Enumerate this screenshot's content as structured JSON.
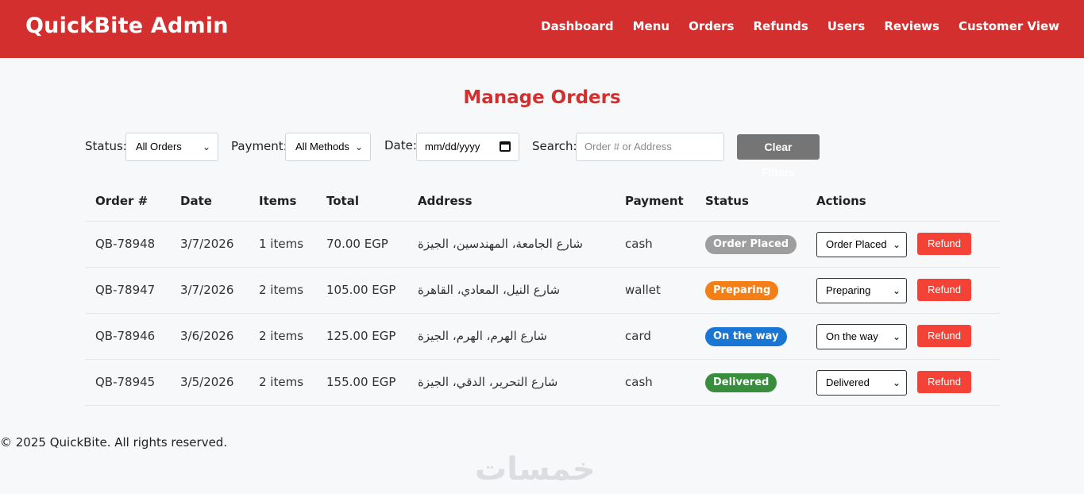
{
  "app": {
    "brand": "QuickBite Admin",
    "nav": [
      "Dashboard",
      "Menu",
      "Orders",
      "Refunds",
      "Users",
      "Reviews",
      "Customer View"
    ]
  },
  "page": {
    "title": "Manage Orders"
  },
  "filters": {
    "status_label": "Status:",
    "status_value": "All Orders",
    "payment_label": "Payment:",
    "payment_value": "All Methods",
    "date_label": "Date:",
    "date_placeholder": "mm/dd/yyyy",
    "search_label": "Search:",
    "search_placeholder": "Order # or Address",
    "clear_label": "Clear Filters"
  },
  "table": {
    "headers": [
      "Order #",
      "Date",
      "Items",
      "Total",
      "Address",
      "Payment",
      "Status",
      "Actions"
    ],
    "rows": [
      {
        "order": "QB-78948",
        "date": "3/7/2026",
        "items": "1 items",
        "total": "70.00 EGP",
        "address": "شارع الجامعة، المهندسين، الجيزة",
        "payment": "cash",
        "status": "Order Placed",
        "status_color": "#9e9e9e",
        "action_value": "Order Placed",
        "refund": "Refund"
      },
      {
        "order": "QB-78947",
        "date": "3/7/2026",
        "items": "2 items",
        "total": "105.00 EGP",
        "address": "شارع النيل، المعادي، القاهرة",
        "payment": "wallet",
        "status": "Preparing",
        "status_color": "#f57f17",
        "action_value": "Preparing",
        "refund": "Refund"
      },
      {
        "order": "QB-78946",
        "date": "3/6/2026",
        "items": "2 items",
        "total": "125.00 EGP",
        "address": "شارع الهرم، الهرم، الجيزة",
        "payment": "card",
        "status": "On the way",
        "status_color": "#1976d2",
        "action_value": "On the way",
        "refund": "Refund"
      },
      {
        "order": "QB-78945",
        "date": "3/5/2026",
        "items": "2 items",
        "total": "155.00 EGP",
        "address": "شارع التحرير، الدقي، الجيزة",
        "payment": "cash",
        "status": "Delivered",
        "status_color": "#388e3c",
        "action_value": "Delivered",
        "refund": "Refund"
      }
    ]
  },
  "footer": {
    "text": "© 2025 QuickBite. All rights reserved."
  },
  "watermark": {
    "text": "خمسات"
  },
  "colors": {
    "primary": "#d32f2f",
    "refund": "#f44336",
    "clear_button": "#757575"
  }
}
